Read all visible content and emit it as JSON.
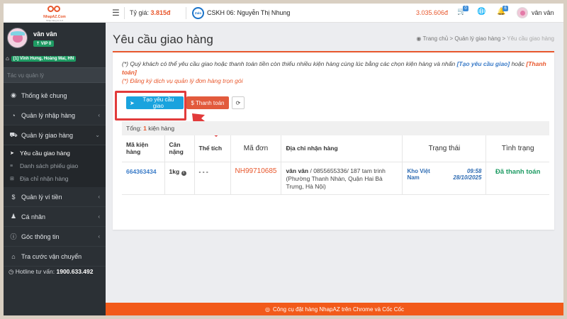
{
  "header": {
    "logo_text": "NhapAZ.Com",
    "logo_sub": "Nhập hàng từ A-Z",
    "rate_label": "Tỷ giá:",
    "rate_value": "3.815đ",
    "zalo_label": "Zalo",
    "support_text": "CSKH 06: Nguyễn Thị Nhung",
    "balance": "3.035.606đ",
    "cart_badge": "0",
    "bell_badge": "6",
    "username": "vân vân"
  },
  "sidebar": {
    "username": "vân vân",
    "vip_label": "VIP 0",
    "address_tag": "[1] Vĩnh Hưng, Hoàng Mai, HN",
    "search_placeholder": "Tác vụ quản lý",
    "items": [
      {
        "label": "Thống kê chung"
      },
      {
        "label": "Quản lý nhập hàng"
      },
      {
        "label": "Quản lý giao hàng"
      },
      {
        "label": "Quản lý ví tiền"
      },
      {
        "label": "Cá nhân"
      },
      {
        "label": "Góc thông tin"
      },
      {
        "label": "Tra cước vận chuyển"
      }
    ],
    "sub_items": [
      {
        "label": "Yêu cầu giao hàng"
      },
      {
        "label": "Danh sách phiếu giao"
      },
      {
        "label": "Địa chỉ nhận hàng"
      }
    ],
    "hotline_label": "Hotline tư vấn:",
    "hotline_number": "1900.633.492"
  },
  "page": {
    "title": "Yêu cầu giao hàng",
    "breadcrumb": {
      "home": "Trang chủ",
      "level1": "Quản lý giao hàng",
      "current": "Yêu cầu giao hàng"
    },
    "note1_text": "(*) Quý khách có thể yêu cầu giao hoặc thanh toán tiền còn thiếu nhiều kiện hàng cùng lúc bằng các chọn kiện hàng và nhấn",
    "note1_link": "[Tạo yêu cầu giao]",
    "note1_or": "hoặc",
    "note1_link2": "[Thanh toán]",
    "note2": "(*) Đăng ký dịch vụ quản lý đơn hàng trọn gói",
    "btn_create": "Tạo yêu cầu giao",
    "btn_pay": "$ Thanh toán",
    "total_label": "Tổng:",
    "total_count": "1",
    "total_unit": "kiện hàng"
  },
  "table": {
    "headers": {
      "code": "Mã kiện hàng",
      "weight": "Cân nặng",
      "volume": "Thể tích",
      "order": "Mã đơn",
      "address": "Địa chỉ nhận hàng",
      "status": "Trạng thái",
      "condition": "Tình trạng"
    },
    "rows": [
      {
        "code": "664363434",
        "weight": "1kg",
        "volume": "- - -",
        "order": "NH99710685",
        "receiver": "vân vân",
        "address": "/ 0855655336/ 187 tam trinh (Phường Thanh Nhàn, Quận Hai Bà Trưng, Hà Nội)",
        "status_place": "Kho Việt Nam",
        "status_time": "09:58",
        "status_date": "28/10/2025",
        "condition": "Đã thanh toán"
      }
    ]
  },
  "footer": {
    "text": "Công cụ đặt hàng NhapAZ trên Chrome và Cốc Cốc"
  },
  "colors": {
    "accent": "#e8572c",
    "sidebar_bg": "#2b3035",
    "primary_button": "#1aa3de",
    "pay_button": "#e25a3c",
    "paid_status": "#1e9b63",
    "highlight": "#e23b3b"
  }
}
